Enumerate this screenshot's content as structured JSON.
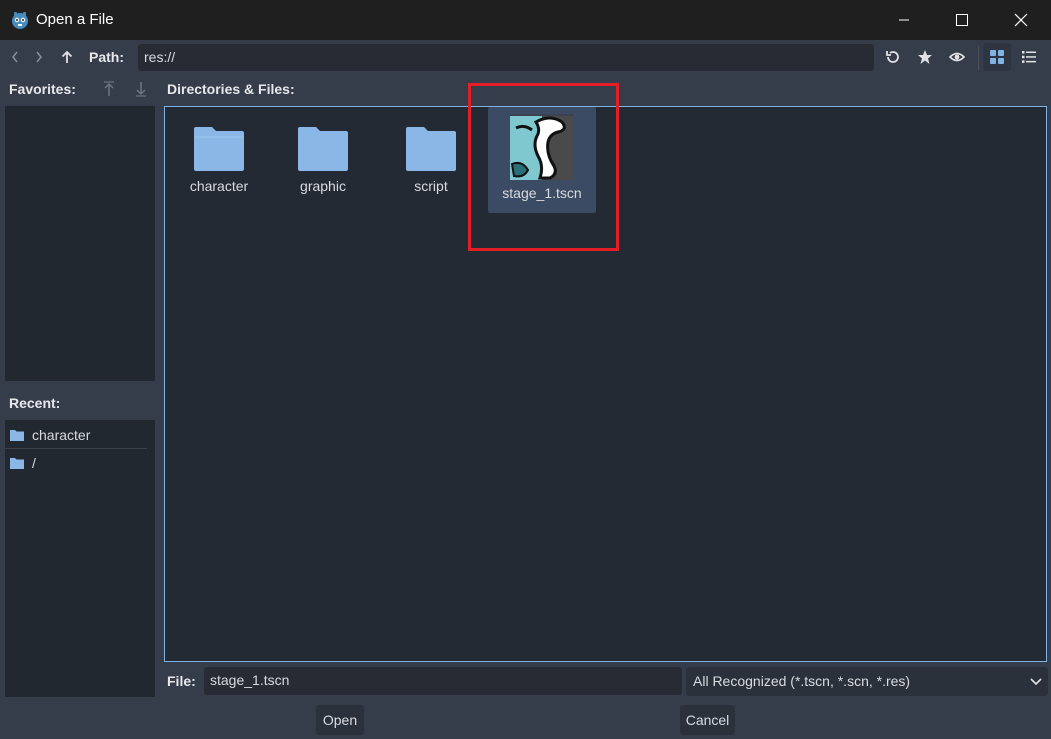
{
  "window": {
    "title": "Open a File",
    "app_icon": "godot-icon"
  },
  "toolbar": {
    "path_label": "Path:",
    "path_value": "res://"
  },
  "favorites": {
    "label": "Favorites:"
  },
  "recent": {
    "label": "Recent:",
    "items": [
      {
        "label": "character",
        "icon": "folder-icon"
      },
      {
        "label": "/",
        "icon": "folder-icon"
      }
    ]
  },
  "files": {
    "label": "Directories & Files:",
    "items": [
      {
        "label": "character",
        "type": "folder"
      },
      {
        "label": "graphic",
        "type": "folder"
      },
      {
        "label": "script",
        "type": "folder"
      },
      {
        "label": "stage_1.tscn",
        "type": "scene",
        "selected": true
      }
    ]
  },
  "footer": {
    "file_label": "File:",
    "file_value": "stage_1.tscn",
    "filter_value": "All Recognized (*.tscn, *.scn, *.res)",
    "open_label": "Open",
    "cancel_label": "Cancel"
  },
  "colors": {
    "accent": "#7fb3e6",
    "folder": "#8ab7e6",
    "highlight": "#e41e26",
    "background": "#363d4a",
    "panel": "#222830"
  }
}
